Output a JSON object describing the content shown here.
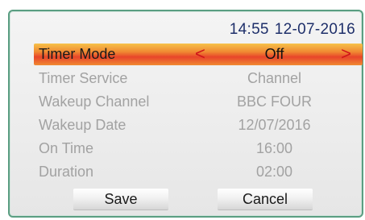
{
  "header": {
    "time": "14:55",
    "date": "12-07-2016"
  },
  "rows": [
    {
      "label": "Timer Mode",
      "value": "Off",
      "selected": true
    },
    {
      "label": "Timer Service",
      "value": "Channel"
    },
    {
      "label": "Wakeup Channel",
      "value": "BBC FOUR"
    },
    {
      "label": "Wakeup Date",
      "value": "12/07/2016"
    },
    {
      "label": "On Time",
      "value": "16:00"
    },
    {
      "label": "Duration",
      "value": "02:00"
    }
  ],
  "arrows": {
    "left": "<",
    "right": ">"
  },
  "buttons": {
    "save_label": "Save",
    "cancel_label": "Cancel"
  },
  "colors": {
    "panel_border": "#5a9e82",
    "datetime_text": "#1e2f6a",
    "highlight_top": "#f6c24a",
    "highlight_mid": "#e8452a",
    "arrow": "#d0141a",
    "inactive_text": "#a2a2a2"
  }
}
